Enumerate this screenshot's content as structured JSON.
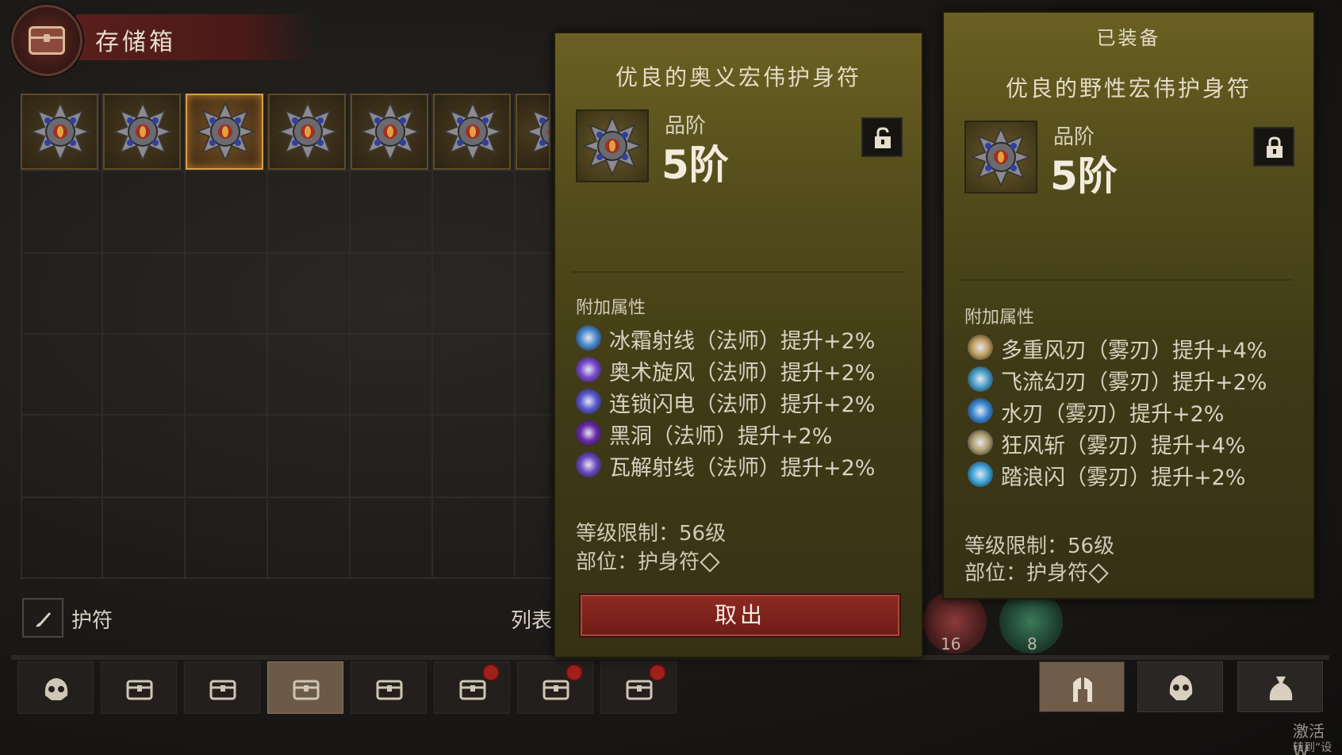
{
  "header": {
    "title": "存储箱"
  },
  "grid": {
    "item_count": 7,
    "selected_index": 2
  },
  "filter": {
    "label": "护符",
    "view_label": "列表"
  },
  "tabs": [
    {
      "icon": "skull-icon",
      "active": false,
      "badge": false
    },
    {
      "icon": "chest-icon",
      "active": false,
      "badge": false
    },
    {
      "icon": "chest-icon",
      "active": false,
      "badge": false
    },
    {
      "icon": "chest-icon",
      "active": true,
      "badge": false
    },
    {
      "icon": "chest-icon",
      "active": false,
      "badge": false
    },
    {
      "icon": "locked-chest-icon",
      "active": false,
      "badge": true
    },
    {
      "icon": "locked-chest-icon",
      "active": false,
      "badge": true
    },
    {
      "icon": "locked-chest-icon",
      "active": false,
      "badge": true
    }
  ],
  "item_panel": {
    "title": "优良的奥义宏伟护身符",
    "rank_label": "品阶",
    "rank_value": "5阶",
    "section_label": "附加属性",
    "affixes": [
      {
        "text": "冰霜射线（法师）提升+2%",
        "icon": "frost-ray-icon",
        "color": "#4a8acd"
      },
      {
        "text": "奥术旋风（法师）提升+2%",
        "icon": "arcane-vortex-icon",
        "color": "#7a4acd"
      },
      {
        "text": "连锁闪电（法师）提升+2%",
        "icon": "chain-lightning-icon",
        "color": "#5a5ad0"
      },
      {
        "text": "黑洞（法师）提升+2%",
        "icon": "black-hole-icon",
        "color": "#6a2aa8"
      },
      {
        "text": "瓦解射线（法师）提升+2%",
        "icon": "disintegrate-icon",
        "color": "#6a4ac0"
      }
    ],
    "level_req": "等级限制：56级",
    "slot": "部位：护身符",
    "action_label": "取出"
  },
  "equipped_panel": {
    "header": "已装备",
    "title": "优良的野性宏伟护身符",
    "rank_label": "品阶",
    "rank_value": "5阶",
    "section_label": "附加属性",
    "affixes": [
      {
        "text": "多重风刃（雾刃）提升+4%",
        "icon": "wind-blades-icon",
        "color": "#c0a060"
      },
      {
        "text": "飞流幻刃（雾刃）提升+2%",
        "icon": "flying-blade-icon",
        "color": "#4aa0c8"
      },
      {
        "text": "水刃（雾刃）提升+2%",
        "icon": "water-blade-icon",
        "color": "#3a8ad0"
      },
      {
        "text": "狂风斩（雾刃）提升+4%",
        "icon": "gale-slash-icon",
        "color": "#b0a070"
      },
      {
        "text": "踏浪闪（雾刃）提升+2%",
        "icon": "wave-dash-icon",
        "color": "#40a8d8"
      }
    ],
    "level_req": "等级限制：56级",
    "slot": "部位：护身符"
  },
  "side_counts": {
    "red_gem": "16",
    "green_gem": "8"
  },
  "right_tabs": [
    {
      "icon": "helmet-icon",
      "active": true
    },
    {
      "icon": "skull-icon",
      "active": false
    },
    {
      "icon": "bag-icon",
      "active": false
    }
  ],
  "watermark": {
    "line1": "激活 W",
    "line2": "转到“设置"
  },
  "colors": {
    "panel_bg": "#514a1a",
    "button": "#8e2a22",
    "selected_slot": "#d8a04a"
  }
}
